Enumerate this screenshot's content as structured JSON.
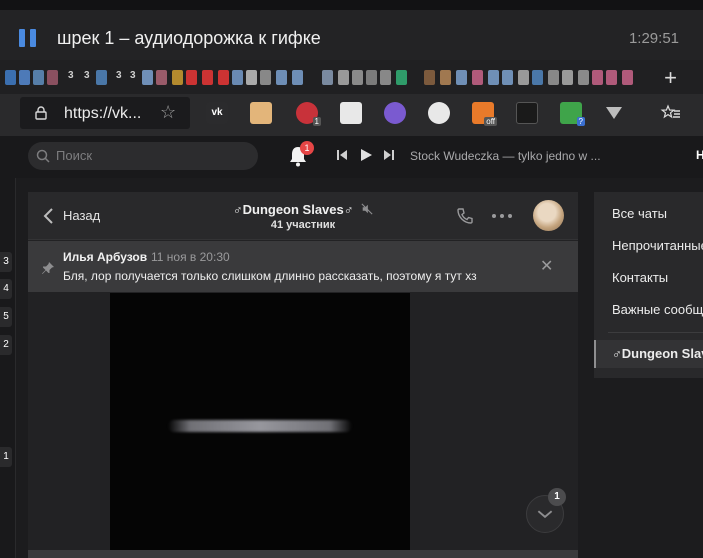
{
  "media": {
    "title": "шрек 1 – аудиодорожка к гифке",
    "time": "1:29:51"
  },
  "tabs": {
    "numbers": [
      "3",
      "3",
      "3",
      "3"
    ],
    "new_tab": "+"
  },
  "address": {
    "url": "https://vk...",
    "extensions": [
      {
        "name": "vk",
        "badge": ""
      },
      {
        "name": "box",
        "badge": ""
      },
      {
        "name": "red-hand",
        "badge": "1"
      },
      {
        "name": "gamepad",
        "badge": ""
      },
      {
        "name": "w",
        "badge": ""
      },
      {
        "name": "dots",
        "badge": ""
      },
      {
        "name": "orange",
        "badge": "off"
      },
      {
        "name": "dark-square",
        "badge": ""
      },
      {
        "name": "download",
        "badge": "?"
      },
      {
        "name": "v",
        "badge": ""
      }
    ]
  },
  "vk": {
    "search_placeholder": "Поиск",
    "bell_count": "1",
    "track": "Stock Wudeczka — tylko jedno w ...",
    "header_letter": "Н"
  },
  "left_badges": [
    "3",
    "4",
    "5",
    "2",
    "1"
  ],
  "chat": {
    "back_label": "Назад",
    "title": "♂Dungeon Slaves♂",
    "subtitle": "41 участник",
    "pinned": {
      "author": "Илья Арбузов",
      "date": "11 ноя в 20:30",
      "text": "Бля, лор получается только слишком длинно рассказать, поэтому я тут хз"
    },
    "unread_count": "1"
  },
  "right_menu": {
    "items": [
      "Все чаты",
      "Непрочитанные",
      "Контакты",
      "Важные сообщения"
    ],
    "active": "♂Dungeon Slaves♂"
  },
  "colors": {
    "accent": "#4a8ae0",
    "badge_red": "#e64646"
  }
}
